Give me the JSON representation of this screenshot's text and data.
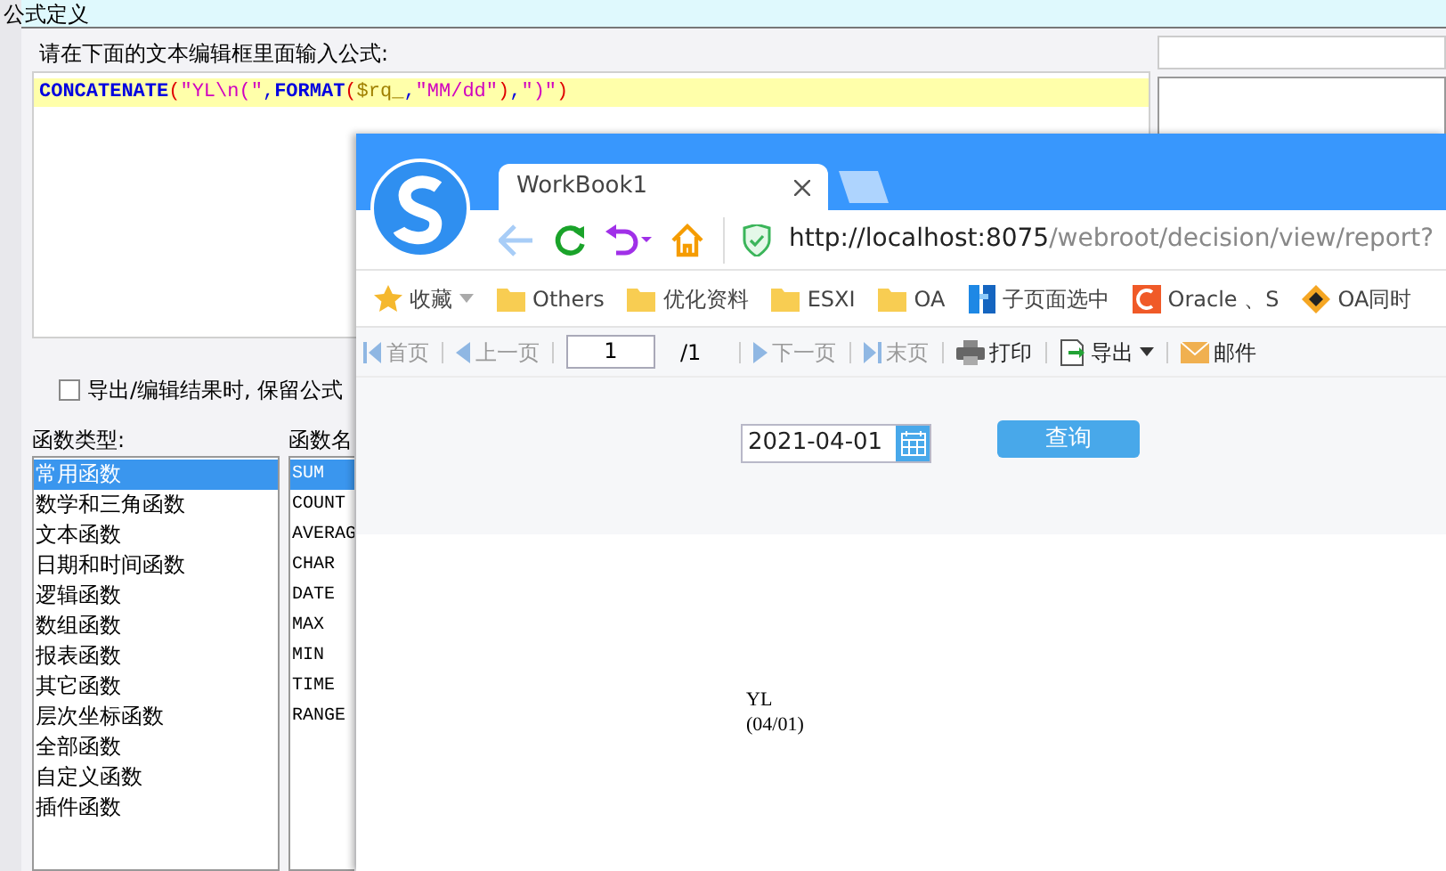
{
  "dialog": {
    "title": "公式定义",
    "prompt": "请在下面的文本编辑框里面输入公式:",
    "formula": [
      {
        "kind": "function",
        "text": "CONCATENATE"
      },
      {
        "kind": "paren",
        "text": "("
      },
      {
        "kind": "string",
        "text": "\"YL\\n(\""
      },
      {
        "kind": "comma",
        "text": ","
      },
      {
        "kind": "function",
        "text": "FORMAT"
      },
      {
        "kind": "paren",
        "text": "("
      },
      {
        "kind": "field",
        "text": "$rq_"
      },
      {
        "kind": "comma",
        "text": ","
      },
      {
        "kind": "string",
        "text": "\"MM/dd\""
      },
      {
        "kind": "paren",
        "text": ")"
      },
      {
        "kind": "comma",
        "text": ","
      },
      {
        "kind": "string",
        "text": "\")\""
      },
      {
        "kind": "paren",
        "text": ")"
      }
    ],
    "keep_formula": {
      "label": "导出/编辑结果时, 保留公式",
      "checked": false
    },
    "categories_label": "函数类型:",
    "categories": [
      {
        "label": "常用函数",
        "selected": true
      },
      {
        "label": "数学和三角函数",
        "selected": false
      },
      {
        "label": "文本函数",
        "selected": false
      },
      {
        "label": "日期和时间函数",
        "selected": false
      },
      {
        "label": "逻辑函数",
        "selected": false
      },
      {
        "label": "数组函数",
        "selected": false
      },
      {
        "label": "报表函数",
        "selected": false
      },
      {
        "label": "其它函数",
        "selected": false
      },
      {
        "label": "层次坐标函数",
        "selected": false
      },
      {
        "label": "全部函数",
        "selected": false
      },
      {
        "label": "自定义函数",
        "selected": false
      },
      {
        "label": "插件函数",
        "selected": false
      }
    ],
    "functions_label": "函数名",
    "functions": [
      {
        "label": "SUM",
        "selected": true
      },
      {
        "label": "COUNT",
        "selected": false
      },
      {
        "label": "AVERAG",
        "selected": false
      },
      {
        "label": "CHAR",
        "selected": false
      },
      {
        "label": "DATE",
        "selected": false
      },
      {
        "label": "MAX",
        "selected": false
      },
      {
        "label": "MIN",
        "selected": false
      },
      {
        "label": "TIME",
        "selected": false
      },
      {
        "label": "RANGE",
        "selected": false
      }
    ]
  },
  "browser": {
    "tab": {
      "title": "WorkBook1"
    },
    "url_host": "http://localhost:8075",
    "url_path": "/webroot/decision/view/report?",
    "bookmarks": [
      {
        "kind": "favorites",
        "label": "收藏"
      },
      {
        "kind": "folder",
        "label": "Others"
      },
      {
        "kind": "folder",
        "label": "优化资料"
      },
      {
        "kind": "folder",
        "label": "ESXI"
      },
      {
        "kind": "folder",
        "label": "OA"
      },
      {
        "kind": "site-f",
        "label": "子页面选中"
      },
      {
        "kind": "site-c",
        "label": "Oracle 、S"
      },
      {
        "kind": "site-o",
        "label": "OA同时"
      }
    ],
    "toolbar": [
      {
        "kind": "first",
        "label": "首页",
        "disabled": true
      },
      {
        "kind": "prev",
        "label": "上一页",
        "disabled": true
      },
      {
        "kind": "page",
        "value": "1",
        "total": "/1"
      },
      {
        "kind": "next",
        "label": "下一页",
        "disabled": true
      },
      {
        "kind": "last",
        "label": "末页",
        "disabled": true
      },
      {
        "kind": "print",
        "label": "打印",
        "disabled": false
      },
      {
        "kind": "export",
        "label": "导出",
        "disabled": false
      },
      {
        "kind": "mail",
        "label": "邮件",
        "disabled": false
      }
    ],
    "date_value": "2021-04-01",
    "query_button": "查询",
    "result_lines": [
      "YL",
      "(04/01)"
    ]
  }
}
